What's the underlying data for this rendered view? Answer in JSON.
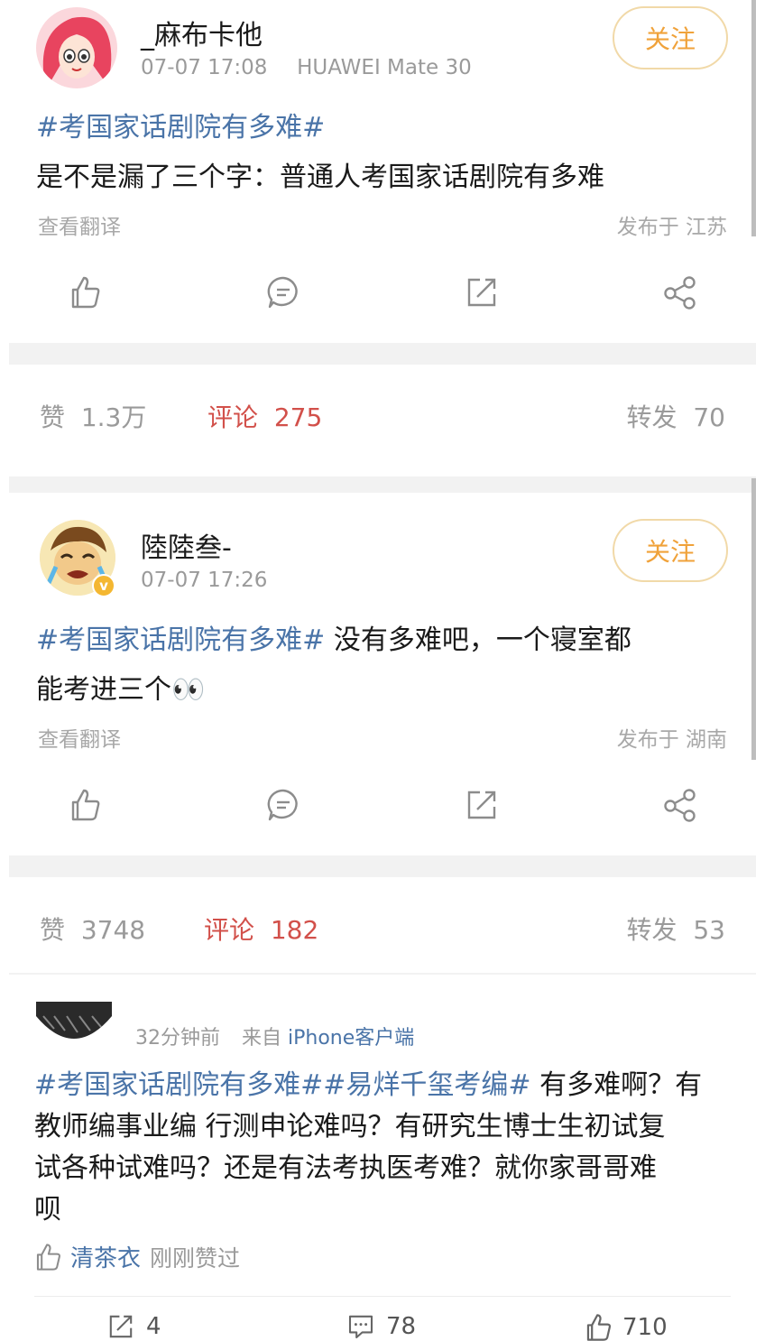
{
  "post1": {
    "username": "_麻布卡他",
    "time": "07-07 17:08",
    "device": "HUAWEI Mate 30",
    "follow_label": "关注",
    "hashtag": "#考国家话剧院有多难#",
    "text": "是不是漏了三个字：普通人考国家话剧院有多难",
    "translate_label": "查看翻译",
    "location": "发布于 江苏",
    "stats": {
      "likes_label": "赞",
      "likes_value": "1.3万",
      "comments_label": "评论",
      "comments_value": "275",
      "reposts_label": "转发",
      "reposts_value": "70"
    }
  },
  "post2": {
    "username": "陸陸叁-",
    "time": "07-07 17:26",
    "follow_label": "关注",
    "hashtag": "#考国家话剧院有多难#",
    "text_line1": " 没有多难吧，一个寝室都",
    "text_line2": "能考进三个",
    "emoji": "👀",
    "translate_label": "查看翻译",
    "location": "发布于 湖南",
    "stats": {
      "likes_label": "赞",
      "likes_value": "3748",
      "comments_label": "评论",
      "comments_value": "182",
      "reposts_label": "转发",
      "reposts_value": "53"
    }
  },
  "post3": {
    "time": "32分钟前",
    "source_prefix": "来自",
    "source": "iPhone客户端",
    "hashtag1": "#考国家话剧院有多难#",
    "hashtag2": "#易烊千玺考编#",
    "text_line1_rest": " 有多难啊？有",
    "text_line2": "教师编事业编 行测申论难吗？有研究生博士生初试复",
    "text_line3": "试各种试难吗？还是有法考执医考难？就你家哥哥难",
    "text_line4": "呗",
    "liker_name": "清茶衣",
    "liked_text": "刚刚赞过",
    "bottom": {
      "reposts": "4",
      "comments": "78",
      "likes": "710"
    }
  },
  "colors": {
    "accent_blue": "#4a74a8",
    "follow_orange": "#f0a23a",
    "comment_red": "#d2504a",
    "grey_text": "#9a9a9a"
  },
  "icons": [
    "thumb-up-icon",
    "comment-icon",
    "share-box-icon",
    "share-nodes-icon"
  ]
}
